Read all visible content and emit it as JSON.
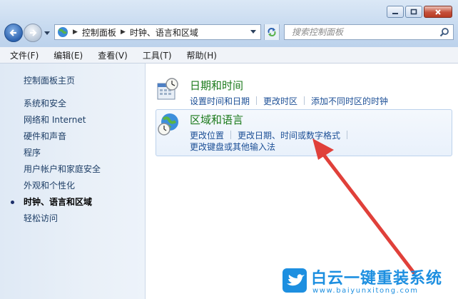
{
  "window": {
    "address": {
      "root": "控制面板",
      "current": "时钟、语言和区域"
    },
    "search": {
      "placeholder": "搜索控制面板"
    }
  },
  "menubar": [
    "文件(F)",
    "编辑(E)",
    "查看(V)",
    "工具(T)",
    "帮助(H)"
  ],
  "sidebar": {
    "home": "控制面板主页",
    "items": [
      {
        "label": "系统和安全",
        "active": false
      },
      {
        "label": "网络和 Internet",
        "active": false
      },
      {
        "label": "硬件和声音",
        "active": false
      },
      {
        "label": "程序",
        "active": false
      },
      {
        "label": "用户帐户和家庭安全",
        "active": false
      },
      {
        "label": "外观和个性化",
        "active": false
      },
      {
        "label": "时钟、语言和区域",
        "active": true
      },
      {
        "label": "轻松访问",
        "active": false
      }
    ]
  },
  "categories": [
    {
      "title": "日期和时间",
      "icon": "calendar-clock-icon",
      "links": [
        "设置时间和日期",
        "更改时区",
        "添加不同时区的时钟"
      ]
    },
    {
      "title": "区域和语言",
      "icon": "globe-clock-icon",
      "links": [
        "更改位置",
        "更改日期、时间或数字格式",
        "更改键盘或其他输入法"
      ]
    }
  ],
  "watermark": {
    "brand": "白云一键重装系统",
    "url": "www.baiyunxitong.com"
  },
  "colors": {
    "category_title": "#1b7a1b",
    "link": "#1c4f96",
    "annotation_arrow": "#e0403a",
    "watermark": "#1d8fe0"
  }
}
